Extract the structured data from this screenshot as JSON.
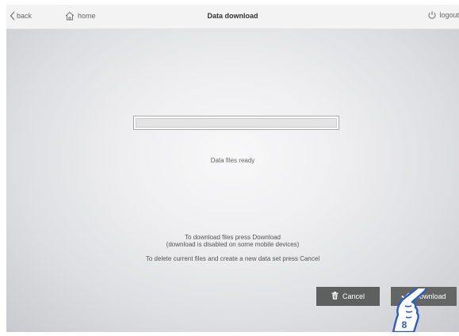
{
  "header": {
    "back_label": "back",
    "home_label": "home",
    "title": "Data download",
    "logout_label": "logout"
  },
  "main": {
    "progress_fraction": 0,
    "status_text": "Data files ready",
    "instruction_line1": "To download files press Download",
    "instruction_line2": "(download is disabled on some mobile devices)",
    "instruction_line3": "To delete current files and create a new data set press Cancel"
  },
  "buttons": {
    "cancel_label": "Cancel",
    "download_label": "Download"
  },
  "pointer": {
    "badge_number": "8"
  },
  "icons": {
    "back": "chevron-left-icon",
    "home": "home-icon",
    "logout": "power-icon",
    "cancel": "trash-icon",
    "download": "checkmark-icon",
    "pointer": "pointing-hand-icon"
  },
  "colors": {
    "progress_fill": "#6d8fbf",
    "button_background": "#5e6060",
    "button_text": "#ffffff",
    "hand_outline": "#2a5cc8"
  }
}
